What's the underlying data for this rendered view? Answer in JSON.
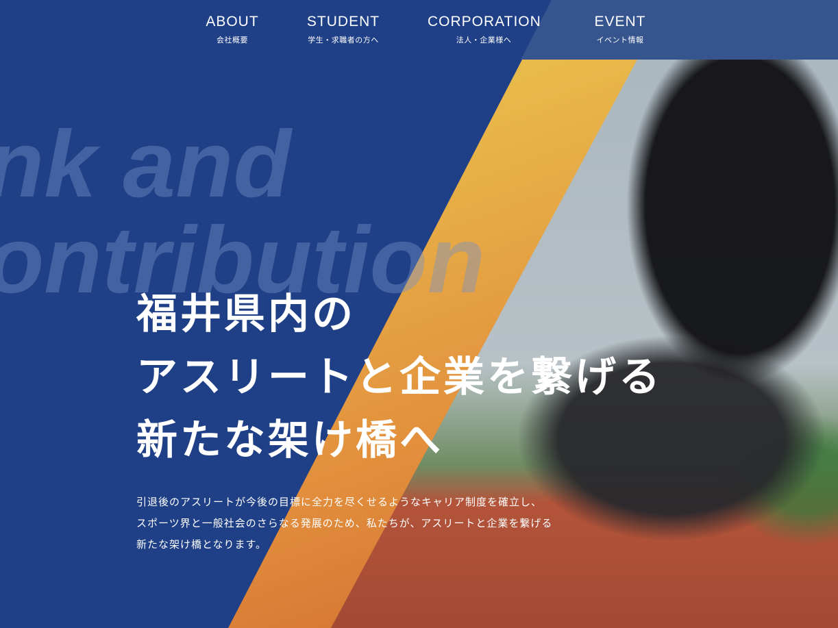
{
  "nav": {
    "items": [
      {
        "label": "ABOUT",
        "sub": "会社概要"
      },
      {
        "label": "STUDENT",
        "sub": "学生・求職者の方へ"
      },
      {
        "label": "CORPORATION",
        "sub": "法人・企業様へ"
      },
      {
        "label": "EVENT",
        "sub": "イベント情報"
      }
    ]
  },
  "background_text": {
    "line1": "nk and",
    "line2": "ontribution"
  },
  "hero": {
    "headline": [
      "福井県内の",
      "アスリートと企業を繋げる",
      "新たな架け橋へ"
    ],
    "body": [
      "引退後のアスリートが今後の目標に全力を尽くせるようなキャリア制度を確立し、",
      "スポーツ界と一般社会のさらなる発展のため、私たちが、アスリートと企業を繋げる",
      "新たな架け橋となります。"
    ]
  },
  "colors": {
    "primary": "#1f3f86",
    "nav_right": "#36558f",
    "accent_yellow": "#ecd45a",
    "accent_orange": "#c8602d"
  }
}
